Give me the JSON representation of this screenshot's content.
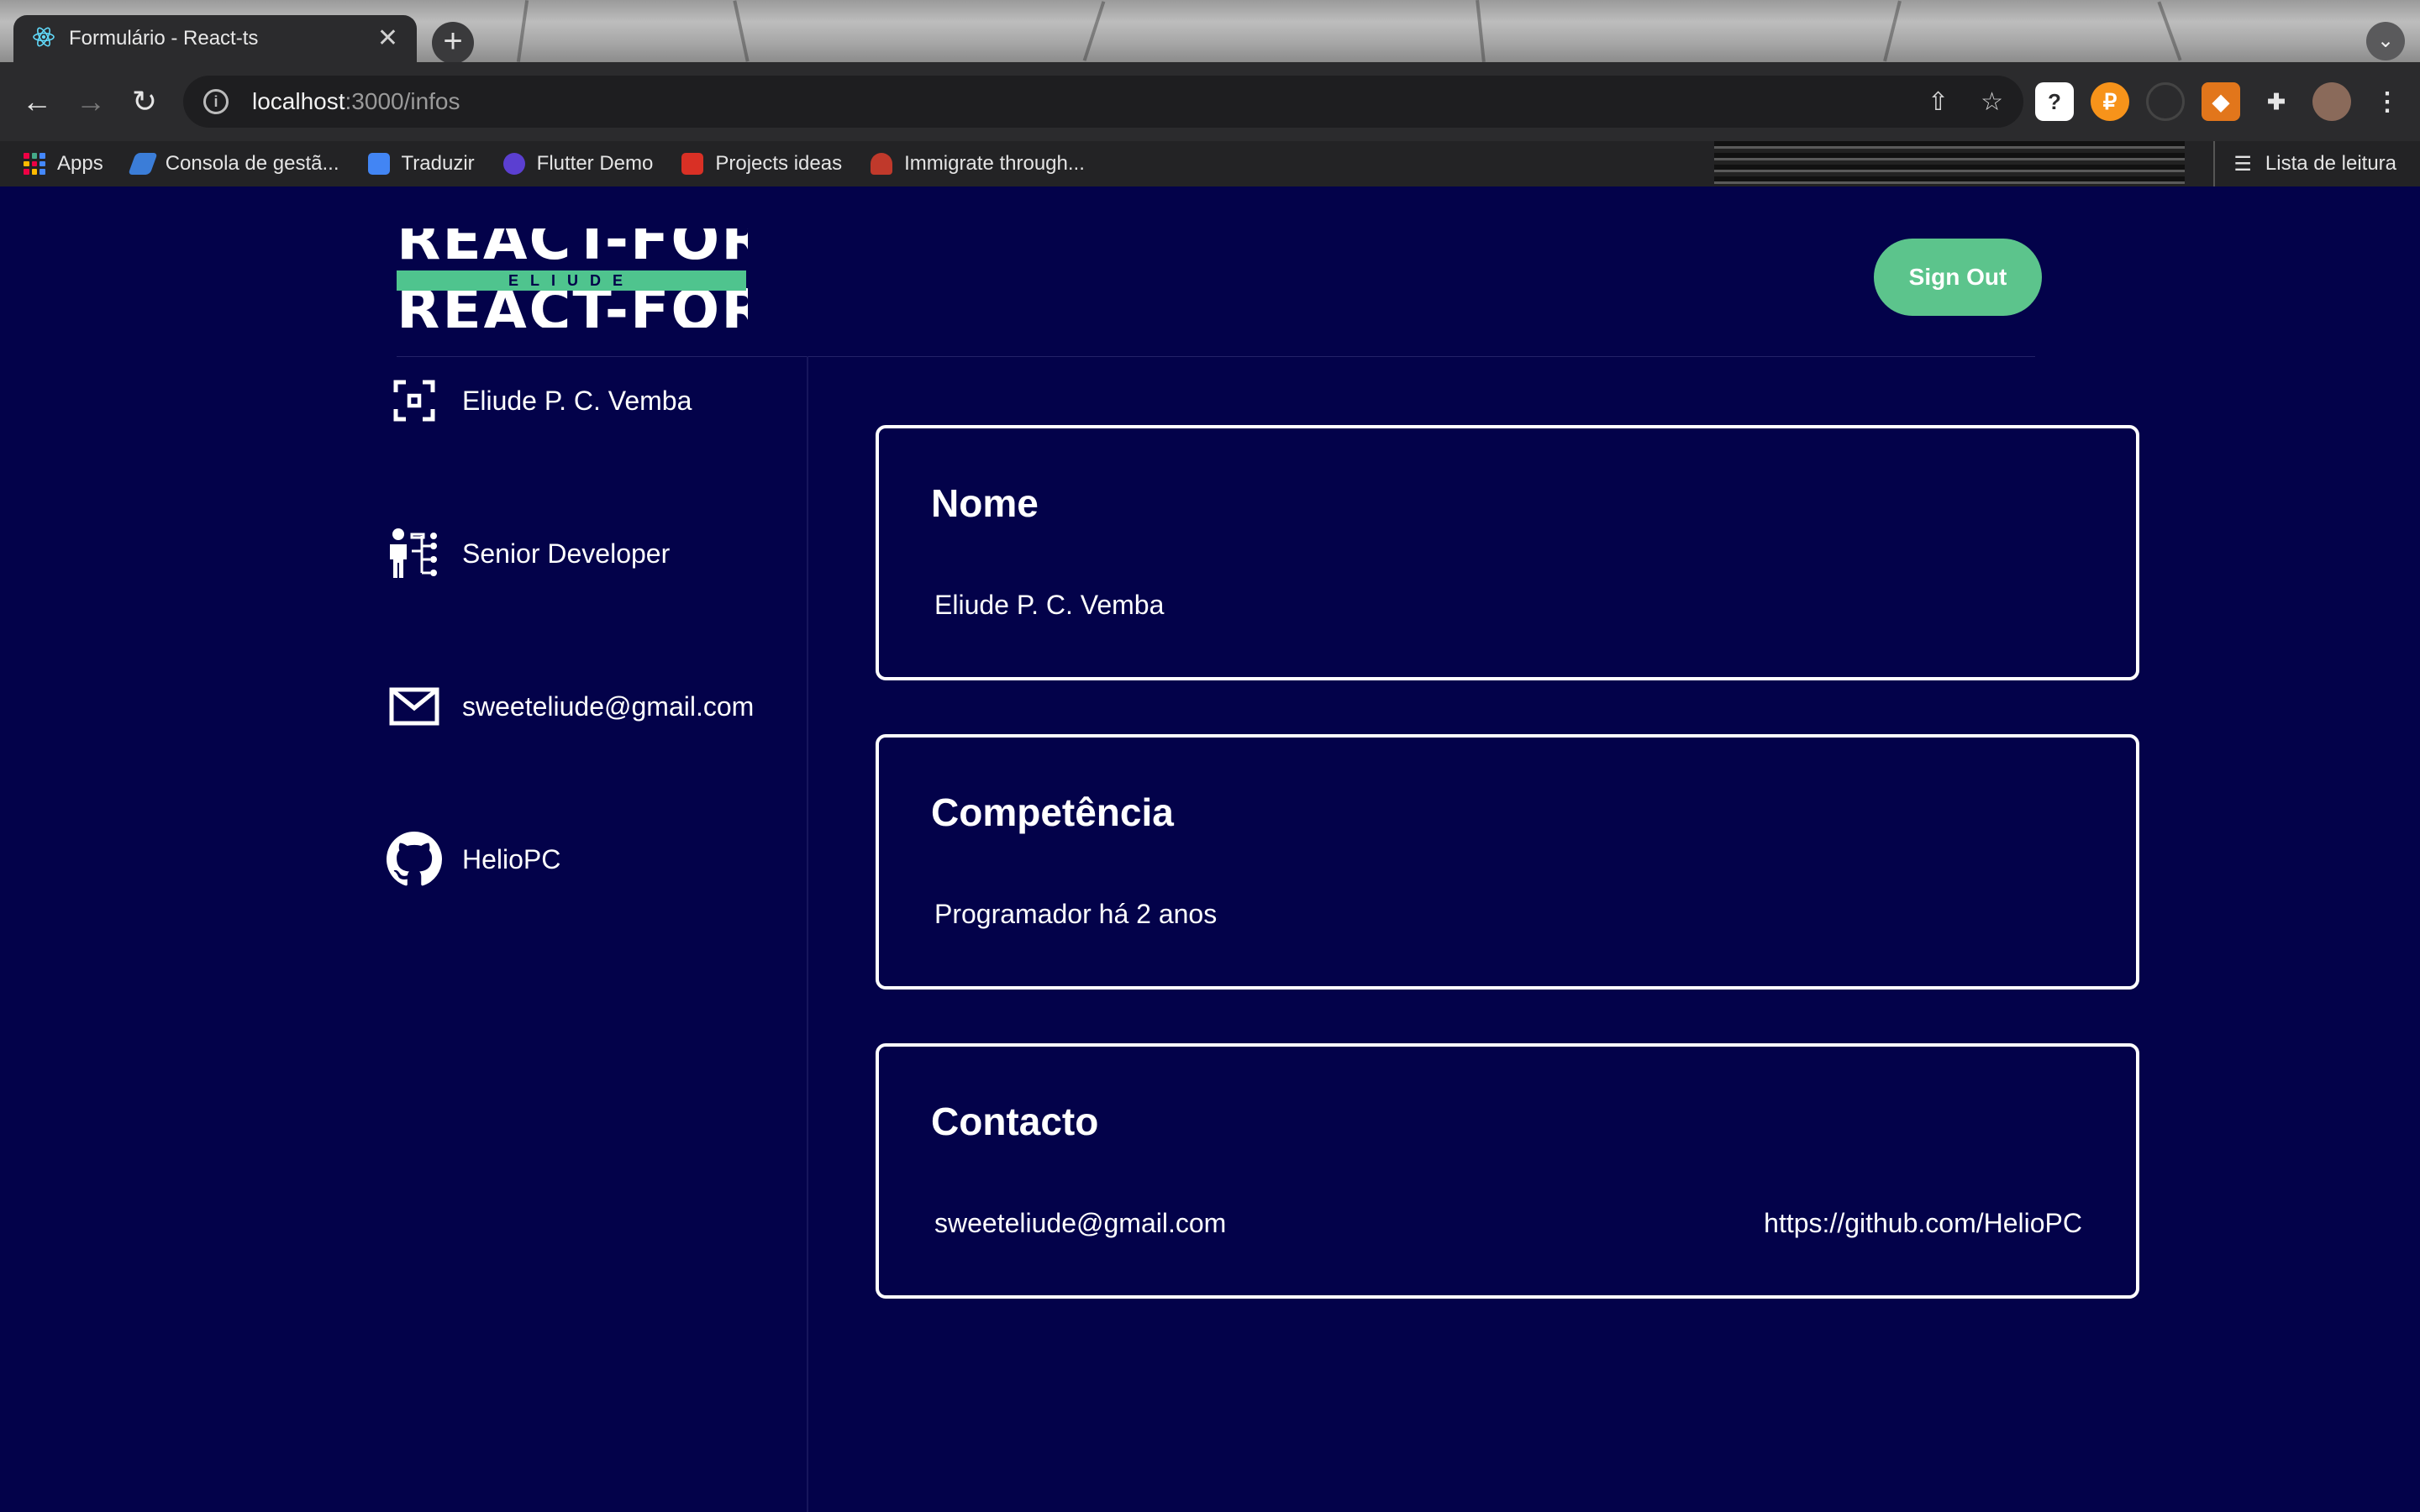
{
  "browser": {
    "tab_title": "Formulário - React-ts",
    "tab_close": "✕",
    "new_tab": "+",
    "url_host": "localhost",
    "url_rest": ":3000/infos",
    "bookmarks": [
      {
        "label": "Apps",
        "icon": "apps-grid-icon"
      },
      {
        "label": "Consola de gestã...",
        "icon": "console-icon"
      },
      {
        "label": "Traduzir",
        "icon": "translate-icon"
      },
      {
        "label": "Flutter Demo",
        "icon": "flutter-icon"
      },
      {
        "label": "Projects ideas",
        "icon": "bookmark-icon"
      },
      {
        "label": "Immigrate through...",
        "icon": "maple-leaf-icon"
      }
    ],
    "reading_list": "Lista de leitura"
  },
  "header": {
    "logo_word": "REACT-FORM",
    "logo_tag": "ELIUDE",
    "signout_label": "Sign Out",
    "signout_color": "#5cc48c"
  },
  "sidebar": {
    "items": [
      {
        "label": "Eliude P. C. Vemba",
        "icon": "focus-frame-icon"
      },
      {
        "label": "Senior Developer",
        "icon": "org-chart-person-icon"
      },
      {
        "label": "sweeteliude@gmail.com",
        "icon": "mail-icon"
      },
      {
        "label": "HelioPC",
        "icon": "github-icon"
      }
    ]
  },
  "cards": {
    "nome": {
      "title": "Nome",
      "value": "Eliude P. C. Vemba"
    },
    "competencia": {
      "title": "Competência",
      "value": "Programador há 2 anos"
    },
    "contacto": {
      "title": "Contacto",
      "email": "sweeteliude@gmail.com",
      "github": "https://github.com/HelioPC"
    }
  },
  "theme": {
    "background": "#03024a",
    "accent": "#5cc48c"
  }
}
